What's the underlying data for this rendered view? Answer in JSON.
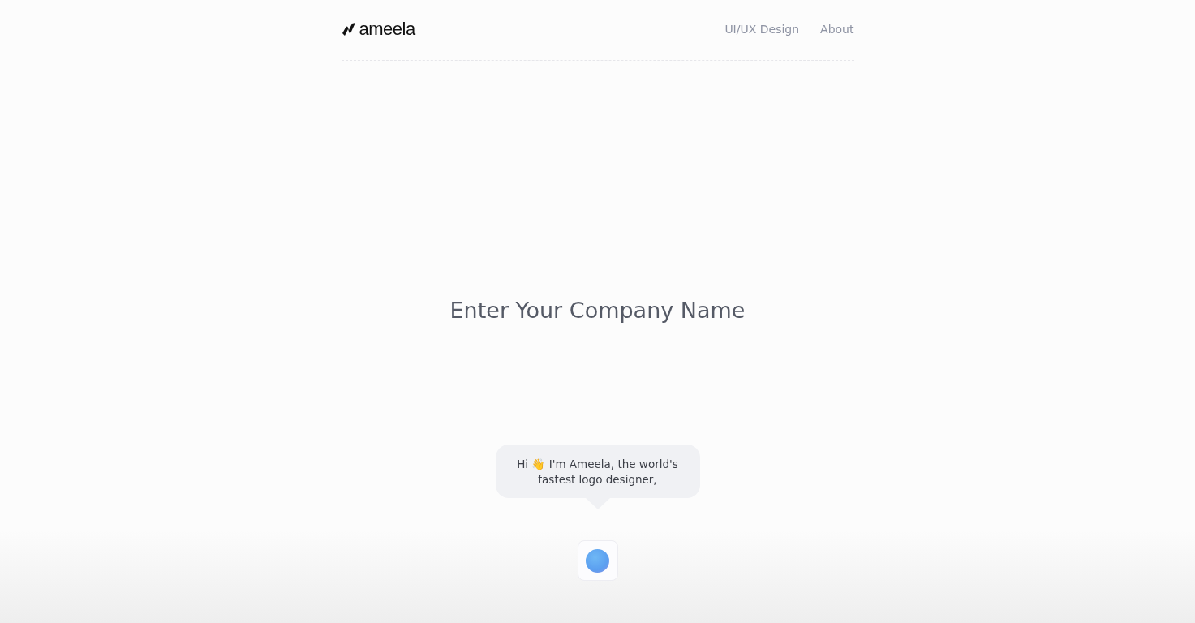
{
  "header": {
    "logo_text": "ameela",
    "nav": [
      {
        "label": "UI/UX Design"
      },
      {
        "label": "About"
      }
    ]
  },
  "heading": "Enter Your Company Name",
  "speech_bubble": {
    "text": "Hi 👋 I'm Ameela, the world's fastest logo designer,"
  },
  "assistant": {
    "kind": "orb"
  }
}
